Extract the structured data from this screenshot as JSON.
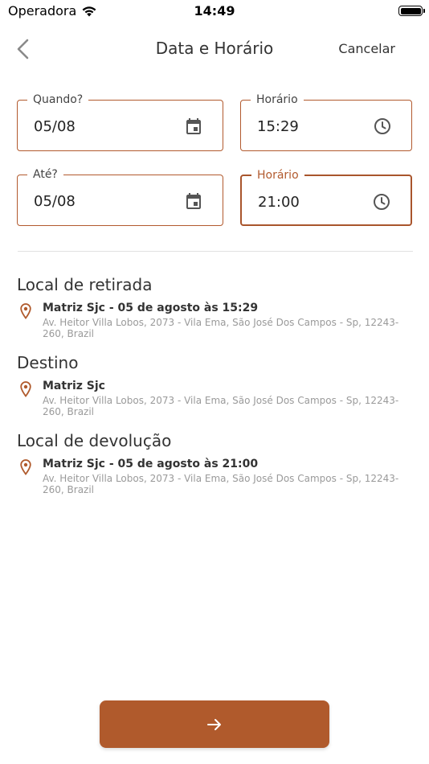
{
  "status_bar": {
    "carrier": "Operadora",
    "time": "14:49"
  },
  "nav": {
    "title": "Data e Horário",
    "cancel_label": "Cancelar",
    "back_icon": "chevron-left-icon"
  },
  "colors": {
    "accent": "#b05a2c",
    "text": "#333333",
    "muted": "#9a9a9a"
  },
  "fields": {
    "start_date": {
      "label": "Quando?",
      "value": "05/08",
      "icon": "calendar-icon"
    },
    "start_time": {
      "label": "Horário",
      "value": "15:29",
      "icon": "clock-icon"
    },
    "end_date": {
      "label": "Até?",
      "value": "05/08",
      "icon": "calendar-icon"
    },
    "end_time": {
      "label": "Horário",
      "value": "21:00",
      "icon": "clock-icon",
      "focused": true
    }
  },
  "sections": {
    "pickup": {
      "title": "Local de retirada",
      "name": "Matriz Sjc - 05 de agosto às 15:29",
      "address": "Av. Heitor Villa Lobos, 2073 - Vila Ema, São José Dos Campos - Sp, 12243-260, Brazil"
    },
    "destination": {
      "title": "Destino",
      "name": "Matriz Sjc",
      "address": "Av. Heitor Villa Lobos, 2073 - Vila Ema, São José Dos Campos - Sp, 12243-260, Brazil"
    },
    "return": {
      "title": "Local de devolução",
      "name": "Matriz Sjc - 05 de agosto às 21:00",
      "address": "Av. Heitor Villa Lobos, 2073 - Vila Ema, São José Dos Campos - Sp, 12243-260, Brazil"
    }
  },
  "next_button": {
    "icon": "arrow-right-icon"
  }
}
